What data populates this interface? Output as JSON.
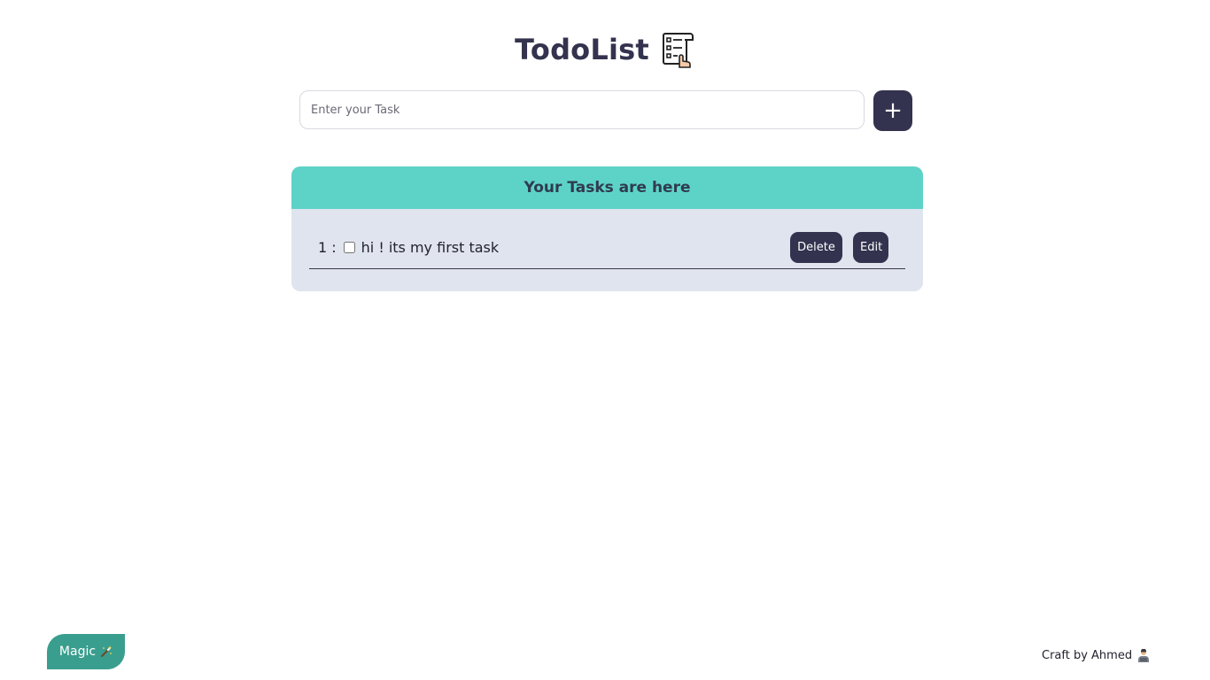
{
  "header": {
    "title": "TodoList",
    "icon": "checklist-icon"
  },
  "task_input": {
    "placeholder": "Enter your Task",
    "value": ""
  },
  "add_button": {
    "label": "+"
  },
  "panel": {
    "title": "Your Tasks are here",
    "tasks": [
      {
        "index": "1 :",
        "text": "hi ! its my first task",
        "checked": false,
        "delete_label": "Delete",
        "edit_label": "Edit"
      }
    ]
  },
  "magic_button": {
    "label": "Magic",
    "icon": "magic-wand-icon"
  },
  "footer": {
    "credit": "Craft by Ahmed",
    "icon": "person-icon"
  },
  "colors": {
    "primary_dark": "#33334f",
    "accent_teal": "#5dd3c7",
    "panel_bg": "#e0e4ee",
    "magic_green": "#3a9e8e"
  }
}
